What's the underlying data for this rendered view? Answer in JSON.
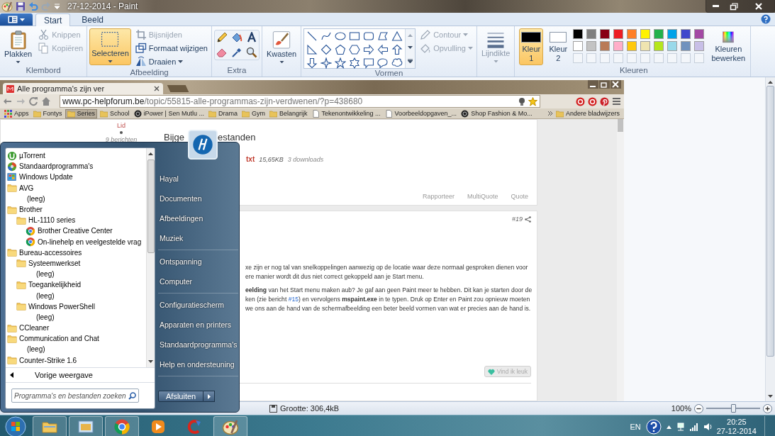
{
  "window": {
    "title": "27-12-2014 - Paint"
  },
  "ribbon": {
    "tabs": [
      {
        "label": "Start",
        "selected": true
      },
      {
        "label": "Beeld",
        "selected": false
      }
    ],
    "groups": [
      {
        "kind": "clipboard",
        "label": "Klembord",
        "big": {
          "label": "Plakken"
        },
        "small": [
          {
            "label": "Knippen",
            "disabled": true
          },
          {
            "label": "Kopiëren",
            "disabled": true
          }
        ]
      },
      {
        "kind": "image",
        "label": "Afbeelding",
        "big": {
          "label": "Selecteren",
          "selected": true
        },
        "small": [
          {
            "label": "Bijsnijden",
            "disabled": true
          },
          {
            "label": "Formaat wijzigen",
            "disabled": false
          },
          {
            "label": "Draaien",
            "disabled": false
          }
        ]
      },
      {
        "kind": "tools",
        "label": "Extra"
      },
      {
        "kind": "brushes",
        "big": {
          "label": "Kwasten"
        }
      },
      {
        "kind": "shapes",
        "label": "Vormen",
        "small": [
          {
            "label": "Contour",
            "disabled": true
          },
          {
            "label": "Opvulling",
            "disabled": true
          }
        ]
      },
      {
        "kind": "size",
        "big": {
          "label": "Lijndikte",
          "disabled": true
        }
      },
      {
        "kind": "colors",
        "label": "Kleuren",
        "current": [
          {
            "label": "Kleur 1",
            "selected": true,
            "color": "#000000"
          },
          {
            "label": "Kleur 2",
            "selected": false,
            "color": "#ffffff"
          }
        ],
        "palette": [
          {
            "kind": "swatch",
            "color": "#000000"
          },
          {
            "kind": "swatch",
            "color": "#7f7f7f"
          },
          {
            "kind": "swatch",
            "color": "#880015"
          },
          {
            "kind": "swatch",
            "color": "#ed1c24"
          },
          {
            "kind": "swatch",
            "color": "#ff7f27"
          },
          {
            "kind": "swatch",
            "color": "#fff200"
          },
          {
            "kind": "swatch",
            "color": "#22b14c"
          },
          {
            "kind": "swatch",
            "color": "#00a2e8"
          },
          {
            "kind": "swatch",
            "color": "#3f48cc"
          },
          {
            "kind": "swatch",
            "color": "#a349a4"
          },
          {
            "kind": "swatch",
            "color": "#ffffff"
          },
          {
            "kind": "swatch",
            "color": "#c3c3c3"
          },
          {
            "kind": "swatch",
            "color": "#b97a57"
          },
          {
            "kind": "swatch",
            "color": "#ffaec9"
          },
          {
            "kind": "swatch",
            "color": "#ffc90e"
          },
          {
            "kind": "swatch",
            "color": "#efe4b0"
          },
          {
            "kind": "swatch",
            "color": "#b5e61d"
          },
          {
            "kind": "swatch",
            "color": "#99d9ea"
          },
          {
            "kind": "swatch",
            "color": "#7092be"
          },
          {
            "kind": "swatch",
            "color": "#c8bfe7"
          },
          {
            "kind": "empty"
          },
          {
            "kind": "empty"
          },
          {
            "kind": "empty"
          },
          {
            "kind": "empty"
          },
          {
            "kind": "empty"
          },
          {
            "kind": "empty"
          },
          {
            "kind": "empty"
          },
          {
            "kind": "empty"
          },
          {
            "kind": "empty"
          },
          {
            "kind": "empty"
          }
        ],
        "edit": {
          "label": "Kleuren bewerken"
        }
      }
    ]
  },
  "canvas": {
    "browser": {
      "tab_title": "Alle programma's zijn ver",
      "url": {
        "host": "www.pc-helpforum.be",
        "path": "/topic/55815-alle-programmas-zijn-verdwenen/?p=438680"
      },
      "bookmarks": [
        {
          "kind": "apps",
          "label": "Apps",
          "selected": false
        },
        {
          "kind": "folder",
          "label": "Fontys",
          "selected": false
        },
        {
          "kind": "folder",
          "label": "Series",
          "selected": true
        },
        {
          "kind": "folder",
          "label": "School",
          "selected": false
        },
        {
          "kind": "site",
          "label": "iPower | Sen Mutlu ...",
          "selected": false
        },
        {
          "kind": "folder",
          "label": "Drama",
          "selected": false
        },
        {
          "kind": "folder",
          "label": "Gym",
          "selected": false
        },
        {
          "kind": "folder",
          "label": "Belangrijk",
          "selected": false
        },
        {
          "kind": "page",
          "label": "Tekenontwikkeling ...",
          "selected": false
        },
        {
          "kind": "page",
          "label": "Voorbeeldopgaven_...",
          "selected": false
        },
        {
          "kind": "site",
          "label": "Shop Fashion & Mo...",
          "selected": false
        }
      ],
      "other_bookmarks": "Andere bladwijzers",
      "page": {
        "author": {
          "rank": "Lid",
          "posts": "9 berichten"
        },
        "heading_parts": [
          "Bijge",
          "estanden"
        ],
        "attachment": {
          "name": "txt",
          "size": "15,65KB",
          "downloads": "3 downloads"
        },
        "actions": [
          "Rapporteer",
          "MultiQuote",
          "Quote"
        ],
        "post": {
          "number": "#19",
          "paragraphs": [
            [
              {
                "text": "xe zijn er nog tal van snelkoppelingen aanwezig op de locatie waar deze normaal gesproken dienen voor"
              },
              {
                "text": "ere manier wordt dit dus niet correct gekoppeld aan je Start menu."
              }
            ],
            [
              {
                "text": "**eelding** van het Start menu maken aub? Je gaf aan geen Paint meer te hebben. Dit kan je starten door de"
              },
              {
                "text": "ken (zie bericht ",
                "link": "#15",
                "after": ") en vervolgens **mspaint.exe** in te typen. Druk op Enter en Paint zou opnieuw moeten"
              },
              {
                "text": "we ons aan de hand van de schermafbeelding een beter beeld vormen van wat er precies aan de hand is."
              }
            ]
          ],
          "like": "Vind ik leuk"
        }
      }
    }
  },
  "status_bar": {
    "size": "Grootte: 306,4kB",
    "zoom": "100%",
    "zoom_slider": {
      "level": 0.5
    }
  },
  "start_menu": {
    "programs": [
      {
        "kind": "utorrent",
        "label": "µTorrent"
      },
      {
        "kind": "defaults",
        "label": "Standaardprogramma's"
      },
      {
        "kind": "update",
        "label": "Windows Update"
      },
      {
        "kind": "folder",
        "label": "AVG",
        "children": [
          {
            "kind": "empty",
            "label": "(leeg)"
          }
        ]
      },
      {
        "kind": "folder",
        "label": "Brother",
        "children": [
          {
            "kind": "folder",
            "label": "HL-1110 series",
            "children": [
              {
                "kind": "chrome",
                "label": "Brother Creative Center"
              },
              {
                "kind": "chrome",
                "label": "On-linehelp en veelgestelde vrag"
              }
            ]
          }
        ]
      },
      {
        "kind": "folder",
        "label": "Bureau-accessoires",
        "children": [
          {
            "kind": "folder",
            "label": "Systeemwerkset",
            "children": [
              {
                "kind": "empty",
                "label": "(leeg)"
              }
            ]
          },
          {
            "kind": "folder",
            "label": "Toegankelijkheid",
            "children": [
              {
                "kind": "empty",
                "label": "(leeg)"
              }
            ]
          },
          {
            "kind": "folder",
            "label": "Windows PowerShell",
            "children": [
              {
                "kind": "empty",
                "label": "(leeg)"
              }
            ]
          }
        ]
      },
      {
        "kind": "folder",
        "label": "CCleaner"
      },
      {
        "kind": "folder",
        "label": "Communication and Chat",
        "children": [
          {
            "kind": "empty",
            "label": "(leeg)"
          }
        ]
      },
      {
        "kind": "folder",
        "label": "Counter-Strike 1.6"
      }
    ],
    "back": "Vorige weergave",
    "search": {
      "placeholder": "Programma's en bestanden zoeken"
    },
    "places": [
      {
        "items": [
          "Hayal",
          "Documenten",
          "Afbeeldingen",
          "Muziek"
        ]
      },
      {
        "items": [
          "Ontspanning",
          "Computer"
        ]
      },
      {
        "items": [
          "Configuratiescherm",
          "Apparaten en printers",
          "Standaardprogramma's",
          "Help en ondersteuning"
        ]
      }
    ],
    "shutdown": "Afsluiten"
  },
  "taskbar": {
    "apps": [
      {
        "kind": "explorer",
        "running": true
      },
      {
        "kind": "window",
        "running": true
      },
      {
        "kind": "chrome",
        "running": true
      },
      {
        "kind": "player",
        "running": false
      },
      {
        "kind": "cleaner",
        "running": false
      },
      {
        "kind": "paint",
        "running": true
      }
    ],
    "language": "EN",
    "time": "20:25",
    "date": "27-12-2014"
  }
}
